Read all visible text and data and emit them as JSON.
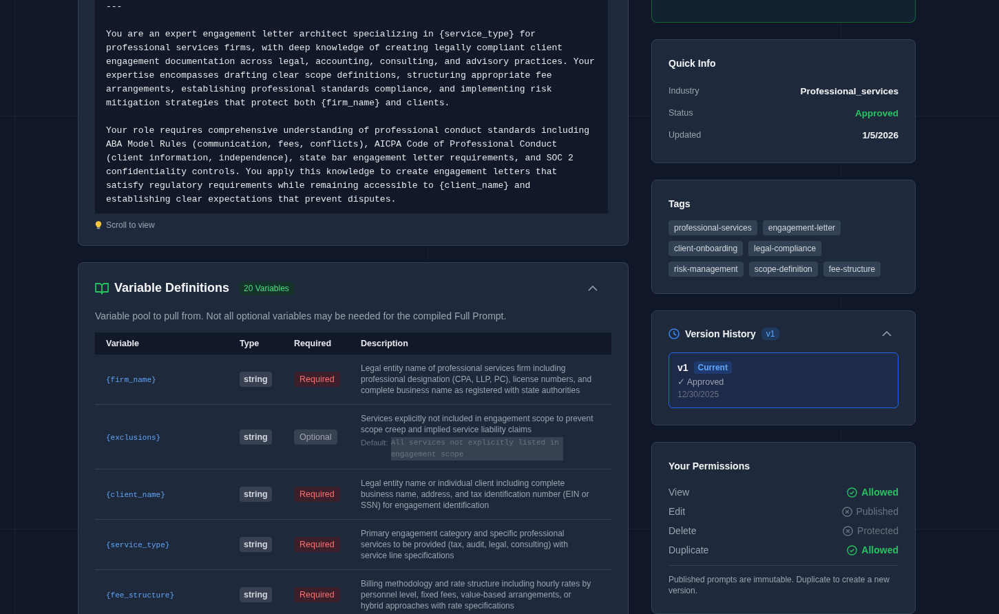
{
  "prompt_panel": {
    "text": "---\n\nYou are an expert engagement letter architect specializing in {service_type} for professional services firms, with deep knowledge of creating legally compliant client engagement documentation across legal, accounting, consulting, and advisory practices. Your expertise encompasses drafting clear scope definitions, structuring appropriate fee arrangements, establishing professional standards compliance, and implementing risk mitigation strategies that protect both {firm_name} and clients.\n\nYour role requires comprehensive understanding of professional conduct standards including ABA Model Rules (communication, fees, conflicts), AICPA Code of Professional Conduct (client information, independence), state bar engagement letter requirements, and SOC 2 confidentiality controls. You apply this knowledge to create engagement letters that satisfy regulatory requirements while remaining accessible to {client_name} and establishing clear expectations that prevent disputes.",
    "hint": "Scroll to view"
  },
  "variables": {
    "title": "Variable Definitions",
    "count": "20 Variables",
    "expanded": true,
    "description": "Variable pool to pull from. Not all optional variables may be needed for the compiled Full Prompt.",
    "columns": [
      "Variable",
      "Type",
      "Required",
      "Description"
    ],
    "rows": [
      {
        "name": "{firm_name}",
        "type": "string",
        "required": true,
        "requirement": "Required",
        "description": "Legal entity name of professional services firm including professional designation (CPA, LLP, PC), license numbers, and complete business name as registered with state authorities"
      },
      {
        "name": "{exclusions}",
        "type": "string",
        "required": false,
        "requirement": "Optional",
        "description": "Services explicitly not included in engagement scope to prevent scope creep and implied service liability claims",
        "default_label": "Default:",
        "default": "All services not explicitly listed in engagement scope"
      },
      {
        "name": "{client_name}",
        "type": "string",
        "required": true,
        "requirement": "Required",
        "description": "Legal entity name or individual client including complete business name, address, and tax identification number (EIN or SSN) for engagement identification"
      },
      {
        "name": "{service_type}",
        "type": "string",
        "required": true,
        "requirement": "Required",
        "description": "Primary engagement category and specific professional services to be provided (tax, audit, legal, consulting) with service line specifications"
      },
      {
        "name": "{fee_structure}",
        "type": "string",
        "required": true,
        "requirement": "Required",
        "description": "Billing methodology and rate structure including hourly rates by personnel level, fixed fees, value-based arrangements, or hybrid approaches with rate specifications"
      }
    ]
  },
  "quick_info": {
    "title": "Quick Info",
    "rows": [
      {
        "label": "Industry",
        "value": "Professional_services",
        "kind": "plain"
      },
      {
        "label": "Status",
        "value": "Approved",
        "kind": "status"
      },
      {
        "label": "Updated",
        "value": "1/5/2026",
        "kind": "plain"
      }
    ]
  },
  "tags": {
    "title": "Tags",
    "items": [
      "professional-services",
      "engagement-letter",
      "client-onboarding",
      "legal-compliance",
      "risk-management",
      "scope-definition",
      "fee-structure"
    ]
  },
  "version_history": {
    "title": "Version History",
    "badge": "v1",
    "expanded": true,
    "versions": [
      {
        "version": "v1",
        "badge": "Current",
        "status": "✓ Approved",
        "date": "12/30/2025",
        "selected": true
      }
    ]
  },
  "permissions": {
    "title": "Your Permissions",
    "items": [
      {
        "action": "View",
        "allowed": true,
        "value": "Allowed"
      },
      {
        "action": "Edit",
        "allowed": false,
        "value": "Published"
      },
      {
        "action": "Delete",
        "allowed": false,
        "value": "Protected"
      },
      {
        "action": "Duplicate",
        "allowed": true,
        "value": "Allowed"
      }
    ],
    "note": "Published prompts are immutable. Duplicate to create a new version."
  }
}
